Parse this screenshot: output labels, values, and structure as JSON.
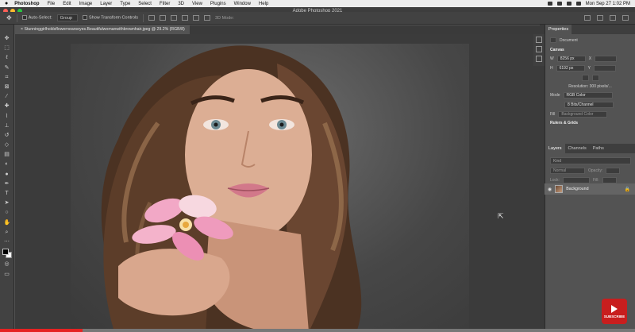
{
  "menubar": {
    "app": "Photoshop",
    "items": [
      "File",
      "Edit",
      "Image",
      "Layer",
      "Type",
      "Select",
      "Filter",
      "3D",
      "View",
      "Plugins",
      "Window",
      "Help"
    ],
    "clock": "Mon Sep 27  1:02 PM"
  },
  "titlebar": {
    "title": "Adobe Photoshop 2021"
  },
  "options": {
    "auto_select": "Auto-Select:",
    "group": "Group",
    "show_transform": "Show Transform Controls",
    "mode_3d": "3D Mode:"
  },
  "document": {
    "tab": "Stunninggirlholdsflowernearseyes.Beautifulwomanwithbrownhair.jpeg @ 29.2% (RGB/8)",
    "close_symbol": "×"
  },
  "properties": {
    "tab": "Properties",
    "doc_label": "Document",
    "canvas_title": "Canvas",
    "w_label": "W",
    "w_value": "8256 px",
    "x_label": "X",
    "h_label": "H",
    "h_value": "6192 px",
    "y_label": "Y",
    "resolution": "Resolution: 300 pixels/...",
    "mode_label": "Mode",
    "mode_value": "RGB Color",
    "bits_value": "8 Bits/Channel",
    "fill_label": "Fill",
    "fill_value": "Background Color",
    "rulers": "Rulers & Grids"
  },
  "layers": {
    "tabs": [
      "Layers",
      "Channels",
      "Paths"
    ],
    "search": "Kind",
    "blend": "Normal",
    "opacity": "Opacity:",
    "lock": "Lock:",
    "fill": "Fill:",
    "layer_name": "Background"
  },
  "subscribe": {
    "label": "SUBSCRIBE"
  },
  "video": {
    "progress_fraction": 0.13
  },
  "colors": {
    "accent_red": "#e52222",
    "panel": "#535353",
    "toolbar": "#424242"
  }
}
